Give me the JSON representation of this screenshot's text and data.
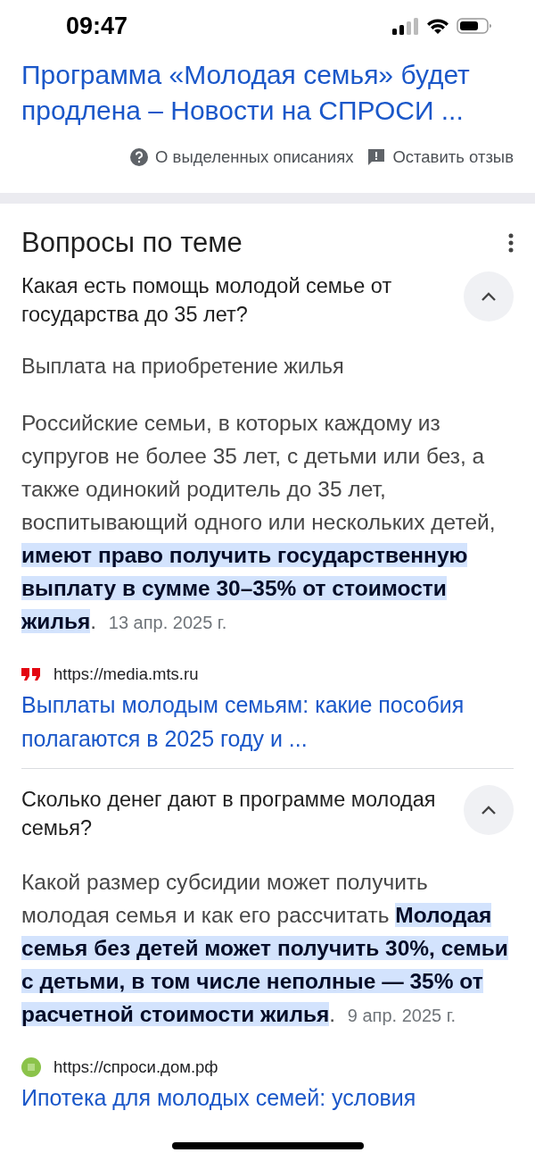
{
  "status_bar": {
    "time": "09:47"
  },
  "top_result": {
    "title_lines": [
      "Программа «Молодая семья» будет",
      "продлена – Новости на СПРОСИ ..."
    ]
  },
  "feedback": [
    {
      "kind": "help",
      "label": "О выделенных описаниях"
    },
    {
      "kind": "report",
      "label": "Оставить отзыв"
    }
  ],
  "related_questions": {
    "title": "Вопросы по теме",
    "items": [
      {
        "question": "Какая есть помощь молодой семье от государства до 35 лет?",
        "expanded": true,
        "answer_title": "Выплата на приобретение жилья",
        "answer_text": "Российские семьи, в которых каждому из супругов не более 35 лет, с детьми или без, а также одинокий родитель до 35 лет, воспитывающий одного или нескольких детей,",
        "answer_highlight": "имеют право получить государственную выплату в сумме 30–35% от стоимости жилья",
        "end_mark": ".",
        "date": "13 апр. 2025 г.",
        "source": {
          "kind": "quote",
          "url": "https://media.mts.ru",
          "title": "Выплаты молодым семьям: какие пособия полагаются в 2025 году и ..."
        }
      },
      {
        "question": "Сколько денег дают в программе молодая семья?",
        "expanded": true,
        "answer_text": "Какой размер субсидии может получить молодая семья и как его рассчитать",
        "answer_highlight": "Молодая семья без детей может получить 30%, семьи с детьми, в том числе неполные — 35% от расчетной стоимости жилья",
        "end_mark": ".",
        "date": "9 апр. 2025 г.",
        "source": {
          "kind": "green",
          "url": "https://спроси.дом.рф",
          "title": "Ипотека для молодых семей: условия"
        }
      }
    ]
  }
}
